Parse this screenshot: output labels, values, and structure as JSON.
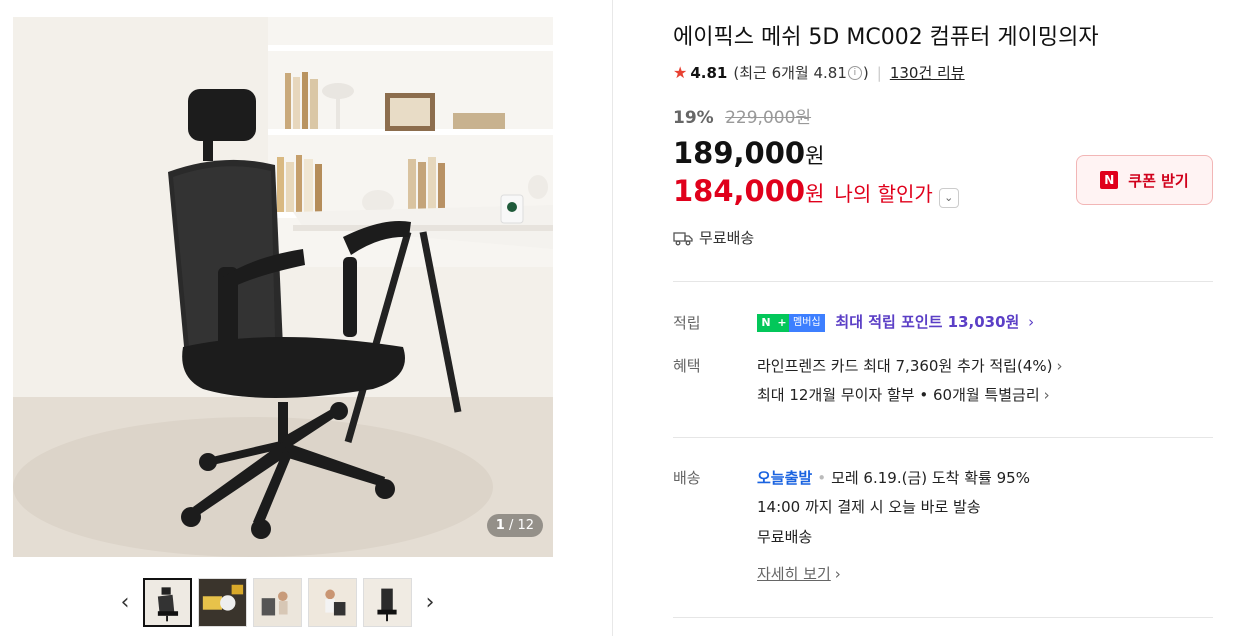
{
  "gallery": {
    "counter_current": "1",
    "counter_total": "/ 12",
    "prev_icon": "chevron-left-icon",
    "next_icon": "chevron-right-icon",
    "thumbnail_count": 5
  },
  "product": {
    "title": "에이픽스 메쉬 5D MC002 컴퓨터 게이밍의자",
    "rating_score": "4.81",
    "rating_recent": "(최근 6개월 4.81",
    "rating_recent_close": ")",
    "review_count": "130건 리뷰",
    "discount_rate": "19%",
    "original_price": "229,000원",
    "price": "189,000",
    "price_unit": "원",
    "my_price": "184,000",
    "my_price_unit": "원",
    "my_price_label": "나의 할인가",
    "shipping_summary": "무료배송"
  },
  "coupon": {
    "label": "쿠폰 받기",
    "badge": "N"
  },
  "details": {
    "points_label": "적립",
    "npay_badge_n": "N",
    "npay_badge_plus": "+",
    "npay_badge_member": "멤버십",
    "points_text": "최대 적립 포인트 13,030원",
    "benefits_label": "혜택",
    "benefit_card": "라인프렌즈 카드 최대 7,360원 추가 적립(4%)",
    "benefit_installment": "최대 12개월 무이자 할부 • 60개월 특별금리",
    "delivery_label": "배송",
    "delivery_today": "오늘출발",
    "delivery_arrival": "모레 6.19.(금) 도착 확률 95%",
    "delivery_cutoff": "14:00 까지 결제 시 오늘 바로 발송",
    "delivery_free": "무료배송",
    "delivery_more": "자세히 보기"
  },
  "colors": {
    "sale_red": "#e0001b",
    "point_purple": "#5b3fc6",
    "today_blue": "#1a63e0",
    "npay_green": "#03c75a"
  }
}
